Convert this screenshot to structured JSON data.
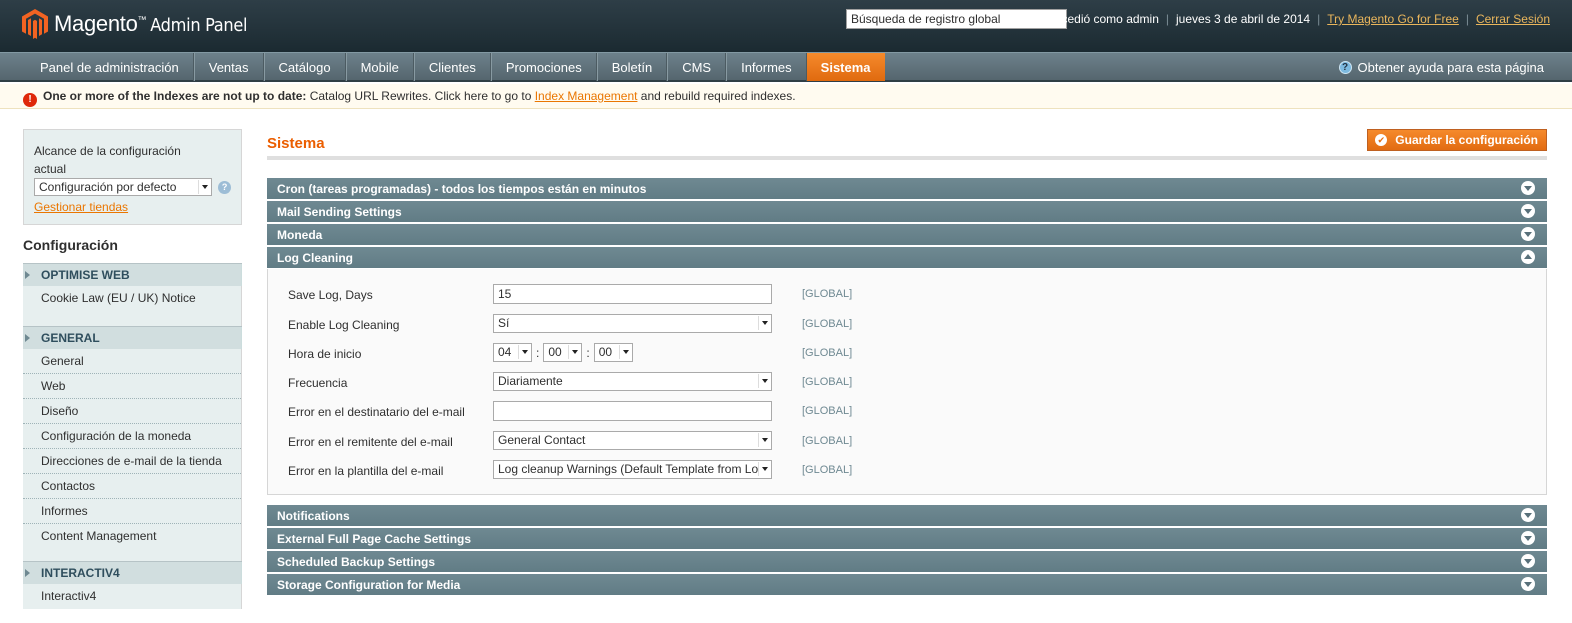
{
  "header": {
    "logo_text": "Magento",
    "logo_sup": "™",
    "logo_suffix": "Admin Panel",
    "search_value": "Búsqueda de registro global",
    "logged_in": "Accedió como admin",
    "date": "jueves 3 de abril de 2014",
    "try_link": "Try Magento Go for Free",
    "logout": "Cerrar Sesión"
  },
  "nav": {
    "items": [
      "Panel de administración",
      "Ventas",
      "Catálogo",
      "Mobile",
      "Clientes",
      "Promociones",
      "Boletín",
      "CMS",
      "Informes",
      "Sistema"
    ],
    "active": "Sistema",
    "help": "Obtener ayuda para esta página"
  },
  "notice": {
    "bold": "One or more of the Indexes are not up to date:",
    "text": "Catalog URL Rewrites. Click here to go to",
    "link": "Index Management",
    "tail": "and rebuild required indexes."
  },
  "sidebar": {
    "scope_label": "Alcance de la configuración actual",
    "scope_value": "Configuración por defecto",
    "manage_stores": "Gestionar tiendas",
    "config_title": "Configuración",
    "groups": [
      {
        "title": "OPTIMISE WEB",
        "items": [
          "Cookie Law (EU / UK) Notice"
        ]
      },
      {
        "title": "GENERAL",
        "items": [
          "General",
          "Web",
          "Diseño",
          "Configuración de la moneda",
          "Direcciones de e-mail de la tienda",
          "Contactos",
          "Informes",
          "Content Management"
        ]
      },
      {
        "title": "INTERACTIV4",
        "items": [
          "Interactiv4"
        ]
      }
    ]
  },
  "main": {
    "title": "Sistema",
    "save_button": "Guardar la configuración",
    "sections_top": [
      "Cron (tareas programadas) - todos los tiempos están en minutos",
      "Mail Sending Settings",
      "Moneda"
    ],
    "open_section": "Log Cleaning",
    "sections_bottom": [
      "Notifications",
      "External Full Page Cache Settings",
      "Scheduled Backup Settings",
      "Storage Configuration for Media"
    ],
    "fields": {
      "save_log_label": "Save Log, Days",
      "save_log_value": "15",
      "enable_label": "Enable Log Cleaning",
      "enable_value": "Sí",
      "start_label": "Hora de inicio",
      "start_hour": "04",
      "start_min": "00",
      "start_sec": "00",
      "freq_label": "Frecuencia",
      "freq_value": "Diariamente",
      "err_recipient_label": "Error en el destinatario del e-mail",
      "err_recipient_value": "",
      "err_sender_label": "Error en el remitente del e-mail",
      "err_sender_value": "General Contact",
      "err_template_label": "Error en la plantilla del e-mail",
      "err_template_value": "Log cleanup Warnings (Default Template from Lo",
      "scope": "[GLOBAL]"
    }
  }
}
